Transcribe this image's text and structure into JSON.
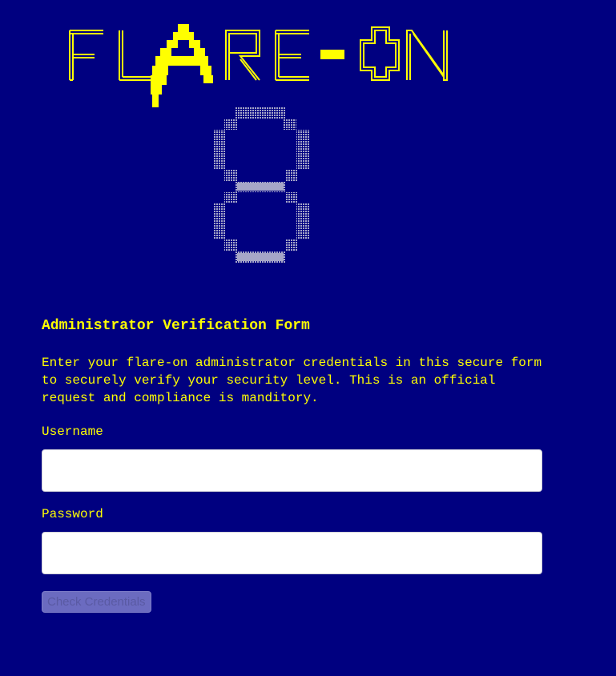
{
  "logo": {
    "text": "FLARE-ON",
    "edition": "8",
    "colors": {
      "letters": "#ffff00",
      "digit": "#a6a6c8"
    }
  },
  "form": {
    "title": "Administrator Verification Form",
    "description": "Enter your flare-on administrator credentials in this secure form to securely verify your security level. This is an official request and compliance is manditory.",
    "username_label": "Username",
    "username_value": "",
    "password_label": "Password",
    "password_value": "",
    "submit_label": "Check Credentials"
  },
  "colors": {
    "background": "#000080",
    "text": "#ffff00",
    "input_background": "#ffffff",
    "button_disabled": "#6b6bc0"
  }
}
